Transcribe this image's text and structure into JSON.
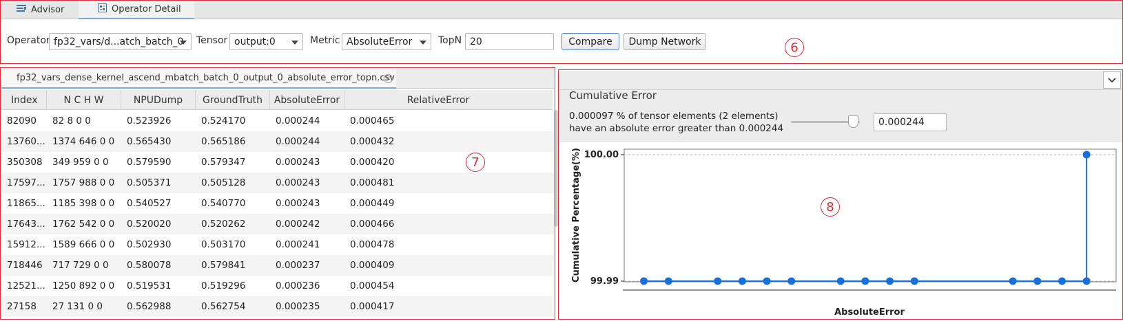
{
  "tabs": {
    "advisor": "Advisor",
    "operator_detail": "Operator Detail"
  },
  "toolbar": {
    "operator_label": "Operator",
    "operator_value": "fp32_vars/d...atch_batch_0",
    "tensor_label": "Tensor",
    "tensor_value": "output:0",
    "metric_label": "Metric",
    "metric_value": "AbsoluteError",
    "topn_label": "TopN",
    "topn_value": "20",
    "compare_label": "Compare",
    "dump_label": "Dump Network"
  },
  "markers": {
    "toolbar": "6",
    "table": "7",
    "chart": "8"
  },
  "table": {
    "file_tab": "fp32_vars_dense_kernel_ascend_mbatch_batch_0_output_0_absolute_error_topn.csv",
    "columns": [
      "Index",
      "N C H W",
      "NPUDump",
      "GroundTruth",
      "AbsoluteError",
      "RelativeError"
    ],
    "rows": [
      [
        "82090",
        "82 8 0 0",
        "0.523926",
        "0.524170",
        "0.000244",
        "0.000465"
      ],
      [
        "13760...",
        "1374 646 0 0",
        "0.565430",
        "0.565186",
        "0.000244",
        "0.000432"
      ],
      [
        "350308",
        "349 959 0 0",
        "0.579590",
        "0.579347",
        "0.000243",
        "0.000420"
      ],
      [
        "17597...",
        "1757 988 0 0",
        "0.505371",
        "0.505128",
        "0.000243",
        "0.000481"
      ],
      [
        "11865...",
        "1185 398 0 0",
        "0.540527",
        "0.540770",
        "0.000243",
        "0.000449"
      ],
      [
        "17643...",
        "1762 542 0 0",
        "0.520020",
        "0.520262",
        "0.000242",
        "0.000466"
      ],
      [
        "15912...",
        "1589 666 0 0",
        "0.502930",
        "0.503170",
        "0.000241",
        "0.000478"
      ],
      [
        "718446",
        "717 729 0 0",
        "0.580078",
        "0.579841",
        "0.000237",
        "0.000409"
      ],
      [
        "12521...",
        "1250 892 0 0",
        "0.519531",
        "0.519296",
        "0.000236",
        "0.000454"
      ],
      [
        "27158",
        "27 131 0 0",
        "0.562988",
        "0.562754",
        "0.000235",
        "0.000417"
      ]
    ]
  },
  "cumulative": {
    "title": "Cumulative Error",
    "desc_line1": "0.000097 % of tensor elements (2 elements)",
    "desc_line2": "have an absolute error greater than 0.000244",
    "threshold_value": "0.000244",
    "slider_fraction": 0.9
  },
  "chart_data": {
    "type": "line",
    "xlabel": "AbsoluteError",
    "ylabel": "Cumulative Percentage(%)",
    "y_ticks": [
      "100.00",
      "99.99"
    ],
    "ylim": [
      99.99,
      100.0
    ],
    "grid": true,
    "x_relative": [
      0.04,
      0.09,
      0.19,
      0.24,
      0.29,
      0.34,
      0.44,
      0.49,
      0.54,
      0.59,
      0.79,
      0.84,
      0.89,
      0.94,
      0.94
    ],
    "y": [
      99.99,
      99.99,
      99.99,
      99.99,
      99.99,
      99.99,
      99.99,
      99.99,
      99.99,
      99.99,
      99.99,
      99.99,
      99.99,
      99.99,
      100.0
    ],
    "line_color": "#1a6fd6"
  }
}
